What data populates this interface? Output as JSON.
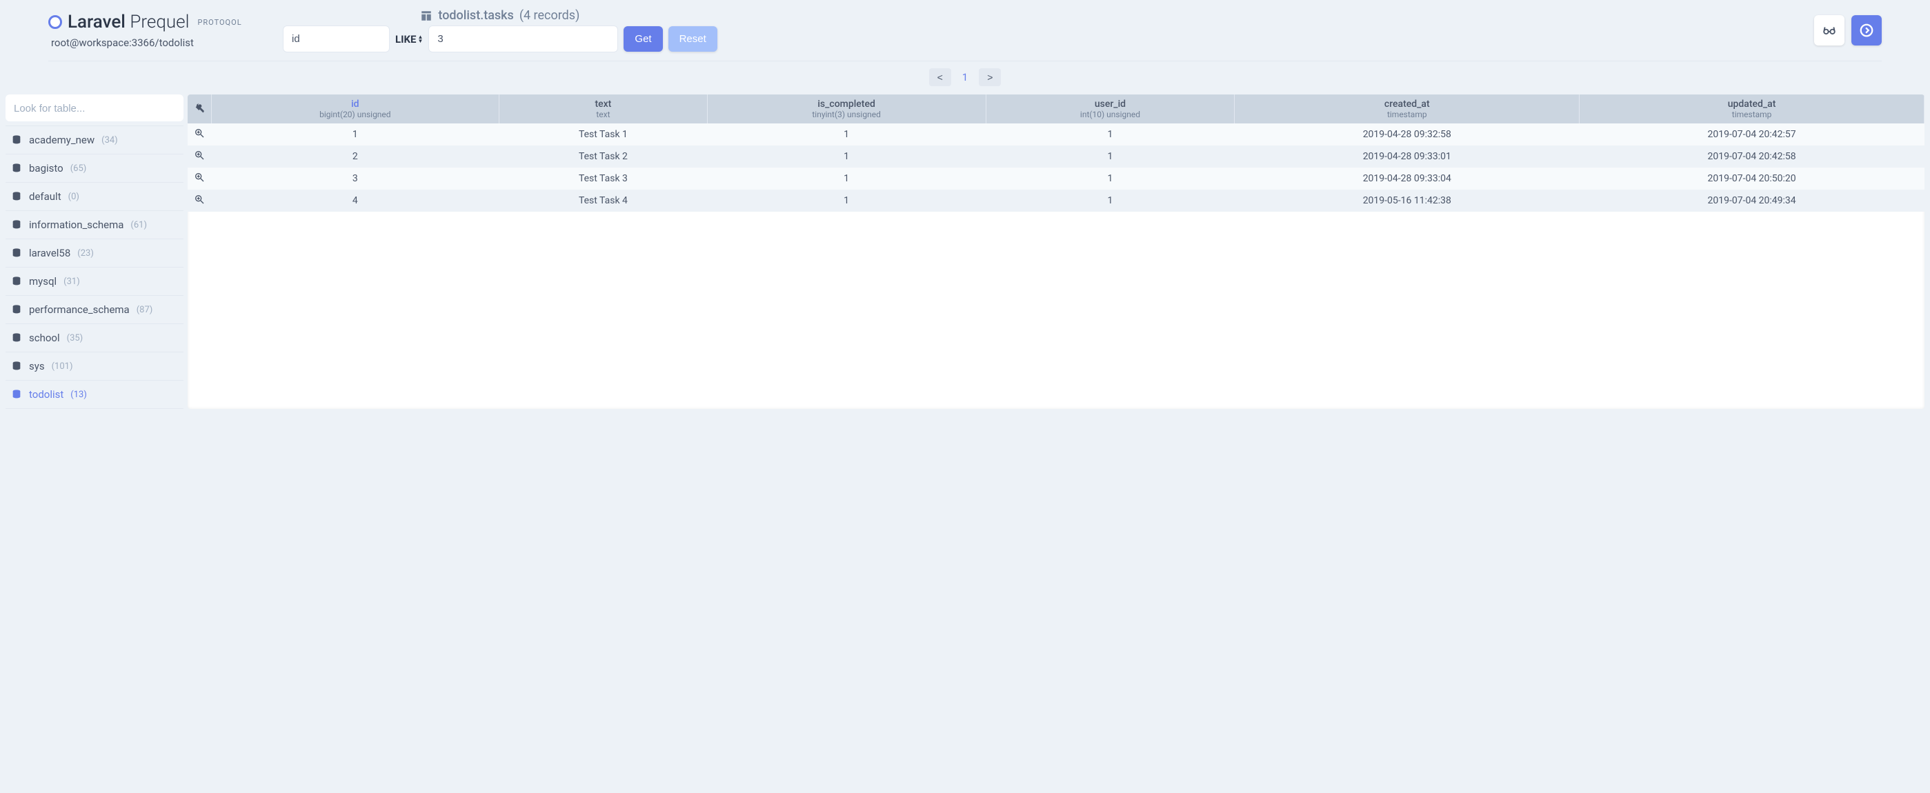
{
  "brand": {
    "main": "Laravel",
    "sub": "Prequel",
    "tag": "PROTOQOL"
  },
  "connection": "root@workspace:3366/todolist",
  "table_title": "todolist.tasks",
  "record_count": "(4 records)",
  "filter": {
    "column_value": "id",
    "operator": "LIKE",
    "value_value": "3",
    "get_label": "Get",
    "reset_label": "Reset"
  },
  "pagination": {
    "prev": "<",
    "page": "1",
    "next": ">"
  },
  "sidebar": {
    "search_placeholder": "Look for table...",
    "items": [
      {
        "name": "academy_new",
        "count": "(34)"
      },
      {
        "name": "bagisto",
        "count": "(65)"
      },
      {
        "name": "default",
        "count": "(0)"
      },
      {
        "name": "information_schema",
        "count": "(61)"
      },
      {
        "name": "laravel58",
        "count": "(23)"
      },
      {
        "name": "mysql",
        "count": "(31)"
      },
      {
        "name": "performance_schema",
        "count": "(87)"
      },
      {
        "name": "school",
        "count": "(35)"
      },
      {
        "name": "sys",
        "count": "(101)"
      },
      {
        "name": "todolist",
        "count": "(13)"
      }
    ]
  },
  "columns": [
    {
      "name": "id",
      "type": "bigint(20) unsigned"
    },
    {
      "name": "text",
      "type": "text"
    },
    {
      "name": "is_completed",
      "type": "tinyint(3) unsigned"
    },
    {
      "name": "user_id",
      "type": "int(10) unsigned"
    },
    {
      "name": "created_at",
      "type": "timestamp"
    },
    {
      "name": "updated_at",
      "type": "timestamp"
    }
  ],
  "rows": [
    {
      "id": "1",
      "text": "Test Task 1",
      "is_completed": "1",
      "user_id": "1",
      "created_at": "2019-04-28 09:32:58",
      "updated_at": "2019-07-04 20:42:57"
    },
    {
      "id": "2",
      "text": "Test Task 2",
      "is_completed": "1",
      "user_id": "1",
      "created_at": "2019-04-28 09:33:01",
      "updated_at": "2019-07-04 20:42:58"
    },
    {
      "id": "3",
      "text": "Test Task 3",
      "is_completed": "1",
      "user_id": "1",
      "created_at": "2019-04-28 09:33:04",
      "updated_at": "2019-07-04 20:50:20"
    },
    {
      "id": "4",
      "text": "Test Task 4",
      "is_completed": "1",
      "user_id": "1",
      "created_at": "2019-05-16 11:42:38",
      "updated_at": "2019-07-04 20:49:34"
    }
  ],
  "active_db_index": 9,
  "sorted_col_index": 0
}
